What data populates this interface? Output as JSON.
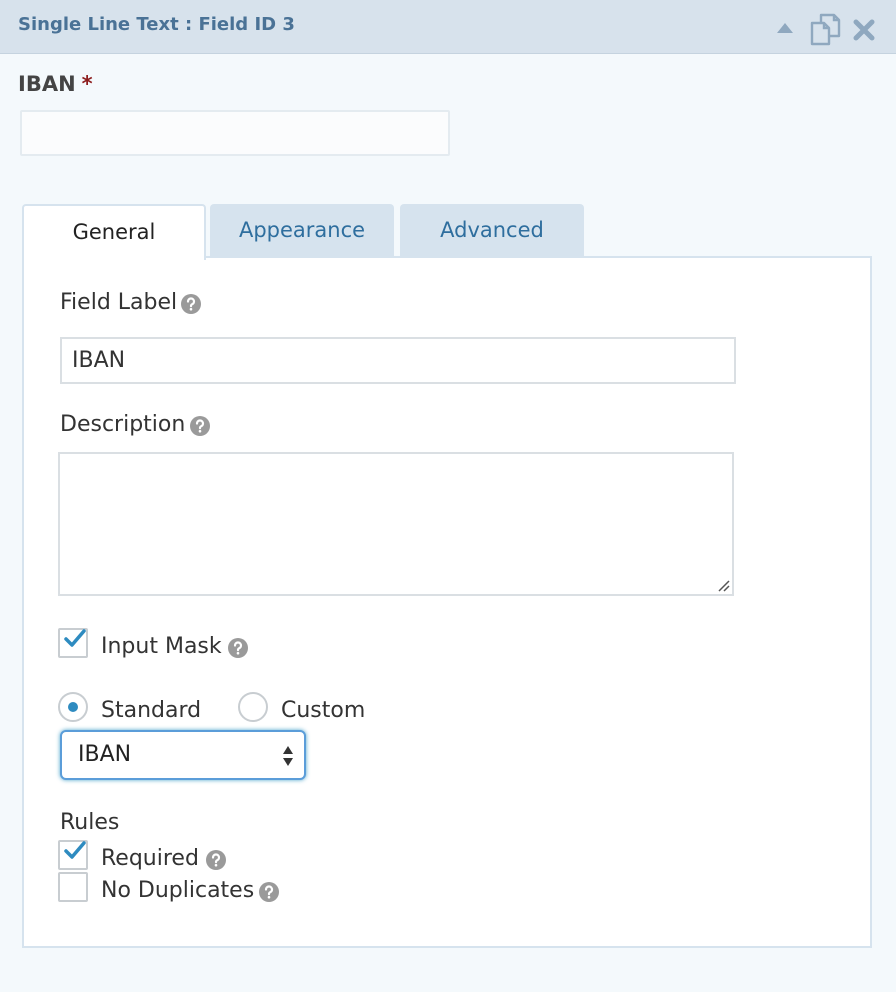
{
  "header": {
    "title": "Single Line Text : Field ID 3",
    "icons": [
      "collapse-icon",
      "duplicate-icon",
      "close-icon"
    ],
    "accent": "#4a7296"
  },
  "preview": {
    "label": "IBAN",
    "required_marker": "*",
    "input_value": ""
  },
  "tabs": [
    {
      "label": "General",
      "active": true
    },
    {
      "label": "Appearance",
      "active": false
    },
    {
      "label": "Advanced",
      "active": false
    }
  ],
  "general": {
    "field_label": {
      "label": "Field Label",
      "value": "IBAN"
    },
    "description": {
      "label": "Description",
      "value": ""
    },
    "input_mask": {
      "label": "Input Mask",
      "checked": true
    },
    "mask_type": {
      "options": [
        {
          "label": "Standard",
          "selected": true
        },
        {
          "label": "Custom",
          "selected": false
        }
      ]
    },
    "mask_select": {
      "value": "IBAN"
    },
    "rules": {
      "title": "Rules",
      "items": [
        {
          "label": "Required",
          "checked": true
        },
        {
          "label": "No Duplicates",
          "checked": false
        }
      ]
    }
  },
  "colors": {
    "check": "#2e8bc0",
    "tab_inactive_bg": "#d6e3ee",
    "tab_inactive_text": "#2e6e9e",
    "required": "#8c1c1c"
  }
}
